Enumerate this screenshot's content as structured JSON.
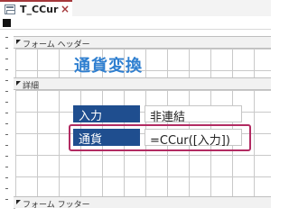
{
  "tab": {
    "title": "T_CCur",
    "icon": "form-icon",
    "close_glyph": "×",
    "accent": "#a4373a"
  },
  "sections": {
    "header": "フォーム ヘッダー",
    "detail": "詳細",
    "footer": "フォーム フッター"
  },
  "form_header": {
    "title": "通貨変換",
    "title_color": "#2f7fd0"
  },
  "detail": {
    "controls": [
      {
        "label": "入力",
        "value": "非連結"
      },
      {
        "label": "通貨",
        "value": "=CCur([入力])"
      }
    ],
    "label_bg": "#1f4e8f",
    "highlight_color": "#b22b62"
  }
}
